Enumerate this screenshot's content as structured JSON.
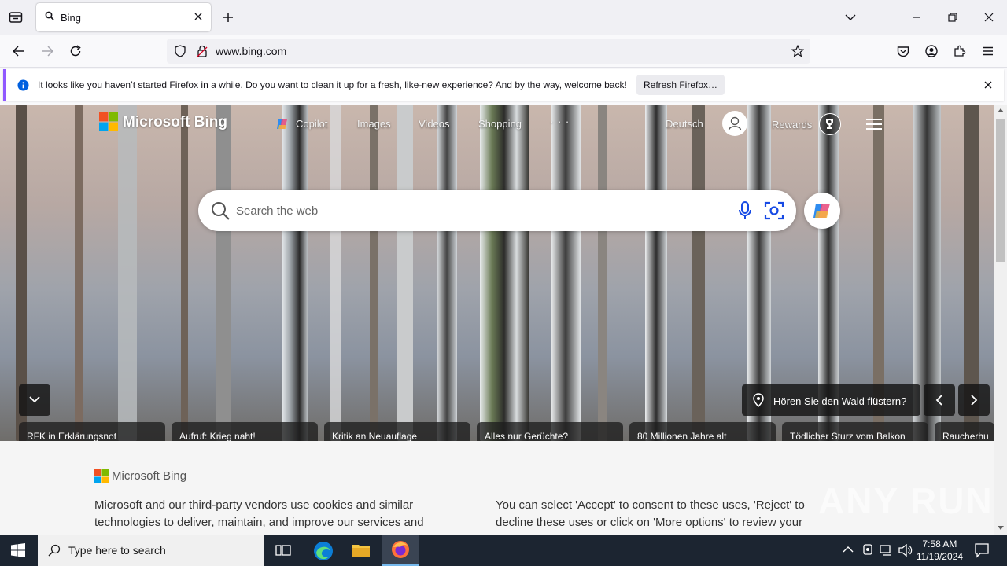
{
  "browser": {
    "tab_title": "Bing",
    "url": "www.bing.com"
  },
  "notification": {
    "message": "It looks like you haven’t started Firefox in a while. Do you want to clean it up for a fresh, like-new experience? And by the way, welcome back!",
    "button": "Refresh Firefox…"
  },
  "bing": {
    "logo": "Microsoft Bing",
    "nav": [
      "Copilot",
      "Images",
      "Videos",
      "Shopping",
      "· · ·"
    ],
    "language": "Deutsch",
    "rewards": "Rewards",
    "search_placeholder": "Search the web",
    "image_caption": "Hören Sie den Wald flüstern?",
    "news": [
      "RFK in Erklärungsnot",
      "Aufruf: Krieg naht!",
      "Kritik an Neuauflage",
      "Alles nur Gerüchte?",
      "80 Millionen Jahre alt",
      "Tödlicher Sturz vom Balkon",
      "Raucherhu"
    ]
  },
  "consent": {
    "logo": "Microsoft Bing",
    "left": "Microsoft and our third-party vendors use cookies and similar technologies to deliver, maintain, and improve our services and",
    "right": "You can select 'Accept' to consent to these uses, 'Reject' to decline these uses or click on 'More options' to review your"
  },
  "taskbar": {
    "search_placeholder": "Type here to search",
    "time": "7:58 AM",
    "date": "11/19/2024"
  },
  "watermark": "ANY RUN",
  "colors": {
    "firefox_accent": "#9059ff",
    "taskbar": "#1c2531",
    "info_blue": "#0060df"
  }
}
